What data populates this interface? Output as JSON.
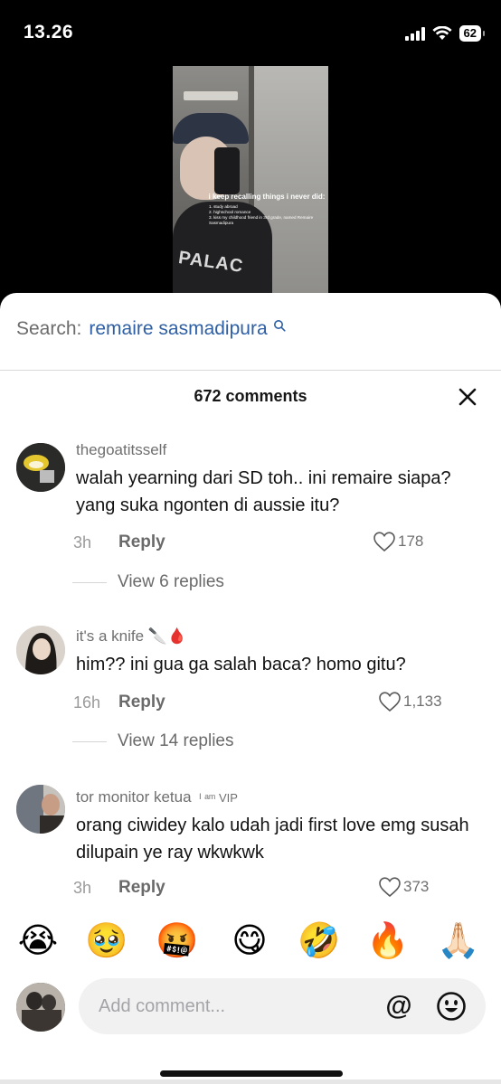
{
  "status_bar": {
    "time": "13.26",
    "battery": "62"
  },
  "video": {
    "caption_title": "i keep recalling things i never did:",
    "caption_items": [
      "1. study abroad",
      "2. highschool romance",
      "3. kiss my childhood friend in 3rd grade, named Remaire Sasmadipura"
    ],
    "shirt_print": "PALAC"
  },
  "search": {
    "label": "Search:",
    "term": "remaire sasmadipura"
  },
  "comments_header": {
    "title": "672 comments"
  },
  "comments": [
    {
      "username": "thegoatitsself",
      "text": "walah yearning dari SD toh.. ini remaire siapa? yang suka ngonten di aussie itu?",
      "time": "3h",
      "reply_label": "Reply",
      "likes": "178",
      "view_replies": "View 6 replies"
    },
    {
      "username": "it's a knife 🔪🩸",
      "text": "him?? ini gua ga salah baca? homo gitu?",
      "time": "16h",
      "reply_label": "Reply",
      "likes": "1,133",
      "view_replies": "View 14 replies"
    },
    {
      "username": "tor monitor ketua",
      "badge": "ᴵ ᵃᵐ VIP",
      "text": "orang ciwidey kalo udah jadi first love emg susah dilupain ye ray wkwkwk",
      "time": "3h",
      "reply_label": "Reply",
      "likes": "373"
    }
  ],
  "emoji_bar": [
    "😭",
    "🥹",
    "🤬",
    "😋",
    "🤣",
    "🔥",
    "🙏🏻"
  ],
  "composer": {
    "placeholder": "Add comment...",
    "mention_symbol": "@"
  },
  "colors": {
    "accent_link": "#2e5fa5",
    "muted_text": "#6f6f6f",
    "input_bg": "#f1f1f2"
  }
}
